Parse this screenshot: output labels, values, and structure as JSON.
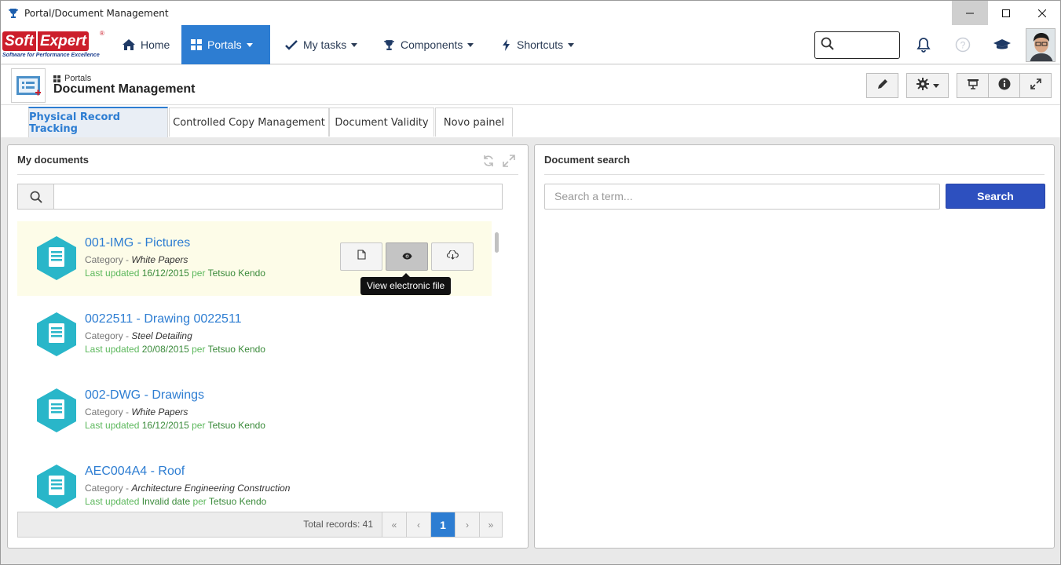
{
  "window": {
    "title": "Portal/Document Management"
  },
  "logo": {
    "brand_a": "Soft",
    "brand_b": "Expert",
    "reg": "®",
    "tagline": "Software for Performance Excellence"
  },
  "nav": {
    "home": "Home",
    "portals": "Portals",
    "my_tasks": "My tasks",
    "components": "Components",
    "shortcuts": "Shortcuts",
    "search_placeholder": ""
  },
  "portal": {
    "crumb": "Portals",
    "title": "Document Management"
  },
  "tabs": [
    {
      "label": "Physical Record Tracking",
      "active": true
    },
    {
      "label": "Controlled Copy Management",
      "active": false
    },
    {
      "label": "Document Validity",
      "active": false
    },
    {
      "label": "Novo painel",
      "active": false
    }
  ],
  "my_documents": {
    "title": "My documents",
    "search_value": "",
    "documents": [
      {
        "name": "001-IMG - Pictures",
        "category_label": "Category - ",
        "category": "White Papers",
        "updated_label": "Last updated ",
        "date": "16/12/2015",
        "per": " per ",
        "user": "Tetsuo Kendo"
      },
      {
        "name": "0022511 - Drawing 0022511",
        "category_label": "Category - ",
        "category": "Steel Detailing",
        "updated_label": "Last updated ",
        "date": "20/08/2015",
        "per": " per ",
        "user": "Tetsuo Kendo"
      },
      {
        "name": "002-DWG - Drawings",
        "category_label": "Category - ",
        "category": "White Papers",
        "updated_label": "Last updated ",
        "date": "16/12/2015",
        "per": " per ",
        "user": "Tetsuo Kendo"
      },
      {
        "name": "AEC004A4 - Roof",
        "category_label": "Category - ",
        "category": "Architecture Engineering Construction",
        "updated_label": "Last updated ",
        "date": "Invalid date",
        "per": " per ",
        "user": "Tetsuo Kendo"
      }
    ],
    "tooltip": "View electronic file",
    "pager": {
      "total": "Total records: 41",
      "first": "«",
      "prev": "‹",
      "current": "1",
      "next": "›",
      "last": "»"
    }
  },
  "document_search": {
    "title": "Document search",
    "placeholder": "Search a term...",
    "button": "Search"
  },
  "colors": {
    "accent": "#2d7dd2",
    "search_button": "#2d50bf",
    "hex_icon": "#29b6c9",
    "link_green": "#5cb85c"
  }
}
